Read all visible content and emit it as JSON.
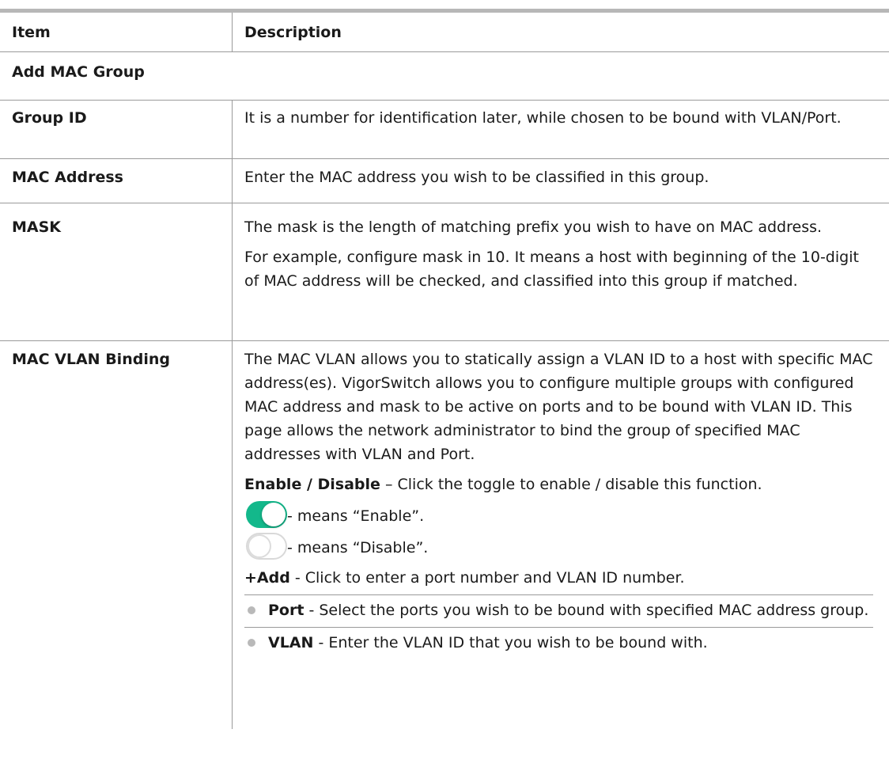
{
  "table": {
    "header": {
      "item": "Item",
      "description": "Description"
    },
    "section_title": "Add MAC Group",
    "rows": {
      "group_id": {
        "item": "Group ID",
        "desc": "It is a number for identification later, while chosen to be bound with VLAN/Port."
      },
      "mac_address": {
        "item": "MAC Address",
        "desc": "Enter the MAC address you wish to be classified in this group."
      },
      "mask": {
        "item": "MASK",
        "desc1": "The mask is the length of matching prefix you wish to have on MAC address.",
        "desc2": "For example, configure mask in 10. It means a host with beginning of the 10-digit of MAC address will be checked, and classified into this group if matched."
      },
      "mac_vlan_binding": {
        "item": "MAC VLAN Binding",
        "desc1": "The MAC VLAN allows you to statically assign a VLAN ID to a host with specific MAC address(es). VigorSwitch allows you to configure multiple groups with configured MAC address and mask to be active on ports and to be bound with VLAN ID. This page allows the network administrator to bind the group of specified MAC addresses with VLAN and Port.",
        "enable_term": "Enable / Disable",
        "enable_desc": " – Click the toggle to enable / disable this function.",
        "toggle_on_text": "- means “Enable”.",
        "toggle_off_text": "- means “Disable”.",
        "add_term": "+Add",
        "add_desc": " - Click to enter a port number and VLAN ID number.",
        "bullets": [
          {
            "term": "Port",
            "desc": " - Select the ports you wish to be bound with specified MAC address group."
          },
          {
            "term": "VLAN",
            "desc": " - Enter the VLAN ID that you wish to be bound with."
          }
        ]
      }
    }
  },
  "colors": {
    "toggle_on": "#13b88b",
    "rule": "#b7b7b7"
  },
  "icons": [
    "toggle-on-icon",
    "toggle-off-icon",
    "bullet-icon"
  ]
}
